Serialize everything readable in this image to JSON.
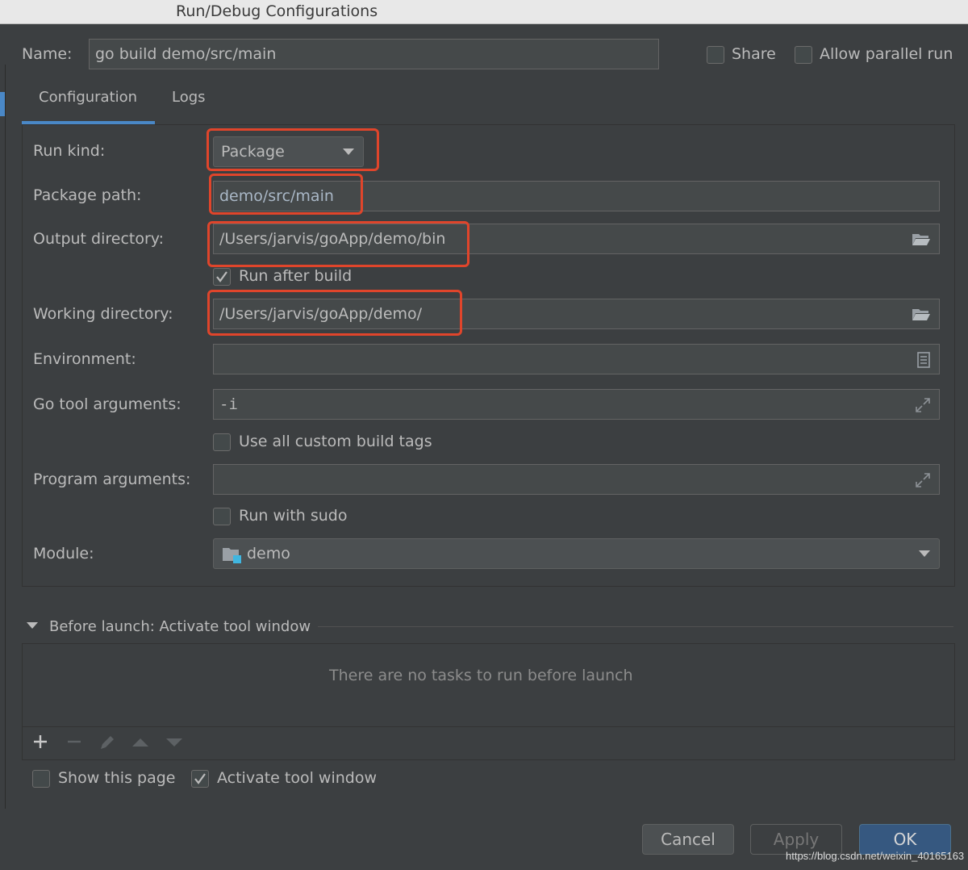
{
  "window": {
    "title": "Run/Debug Configurations"
  },
  "name_row": {
    "label": "Name:",
    "value": "go build demo/src/main",
    "share_label": "Share",
    "allow_parallel_label": "Allow parallel run"
  },
  "tabs": [
    {
      "label": "Configuration",
      "active": true
    },
    {
      "label": "Logs",
      "active": false
    }
  ],
  "config": {
    "run_kind_label": "Run kind:",
    "run_kind_value": "Package",
    "package_path_label": "Package path:",
    "package_path_value": "demo/src/main",
    "output_dir_label": "Output directory:",
    "output_dir_value": "/Users/jarvis/goApp/demo/bin",
    "run_after_build_label": "Run after build",
    "run_after_build_checked": true,
    "working_dir_label": "Working directory:",
    "working_dir_value": "/Users/jarvis/goApp/demo/",
    "environment_label": "Environment:",
    "environment_value": "",
    "go_tool_args_label": "Go tool arguments:",
    "go_tool_args_value": "-i",
    "custom_build_tags_label": "Use all custom build tags",
    "program_args_label": "Program arguments:",
    "program_args_value": "",
    "run_with_sudo_label": "Run with sudo",
    "module_label": "Module:",
    "module_value": "demo"
  },
  "before_launch": {
    "header": "Before launch: Activate tool window",
    "empty_text": "There are no tasks to run before launch",
    "show_this_page_label": "Show this page",
    "activate_tool_window_label": "Activate tool window",
    "activate_tool_window_checked": true
  },
  "buttons": {
    "cancel": "Cancel",
    "apply": "Apply",
    "ok": "OK"
  },
  "watermark": "https://blog.csdn.net/weixin_40165163",
  "colors": {
    "background": "#3c3f41",
    "field": "#45494a",
    "accent": "#4a88c7",
    "highlight": "#e0452b",
    "ok_button": "#365880"
  }
}
